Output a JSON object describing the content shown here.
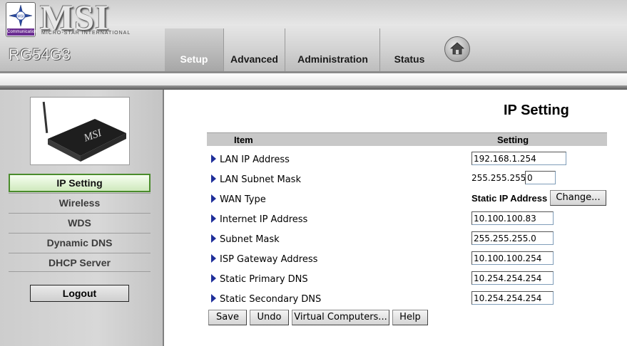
{
  "header": {
    "brand": "MSI",
    "brand_sub": "MICRO-STAR INTERNATIONAL",
    "logo_caption": "Communication",
    "logo_text": "MSI",
    "model": "RG54G3",
    "tabs": [
      {
        "label": "Setup",
        "active": true
      },
      {
        "label": "Advanced",
        "active": false
      },
      {
        "label": "Administration",
        "active": false
      },
      {
        "label": "Status",
        "active": false
      }
    ],
    "home_icon": "home-icon"
  },
  "sidebar": {
    "product_image": "router-image",
    "product_brand": "MSI",
    "items": [
      {
        "label": "IP Setting",
        "active": true
      },
      {
        "label": "Wireless",
        "active": false
      },
      {
        "label": "WDS",
        "active": false
      },
      {
        "label": "Dynamic DNS",
        "active": false
      },
      {
        "label": "DHCP Server",
        "active": false
      }
    ],
    "logout_label": "Logout"
  },
  "main": {
    "title": "IP Setting",
    "table": {
      "col_item": "Item",
      "col_setting": "Setting",
      "rows": [
        {
          "label": "LAN IP Address",
          "value": "192.168.1.254"
        },
        {
          "label": "LAN Subnet Mask",
          "prefix": "255.255.255.",
          "value": "0"
        },
        {
          "label": "WAN Type",
          "value": "Static IP Address",
          "button": "Change..."
        },
        {
          "label": "Internet IP Address",
          "value": "10.100.100.83"
        },
        {
          "label": "Subnet Mask",
          "value": "255.255.255.0"
        },
        {
          "label": "ISP Gateway Address",
          "value": "10.100.100.254"
        },
        {
          "label": "Static Primary DNS",
          "value": "10.254.254.254"
        },
        {
          "label": "Static Secondary DNS",
          "value": "10.254.254.254"
        }
      ]
    },
    "buttons": {
      "save": "Save",
      "undo": "Undo",
      "virtual": "Virtual Computers...",
      "help": "Help"
    }
  },
  "colors": {
    "active_menu_border": "#4a8c2c",
    "arrow": "#1f2f9a",
    "table_header": "#c8c8c8"
  }
}
